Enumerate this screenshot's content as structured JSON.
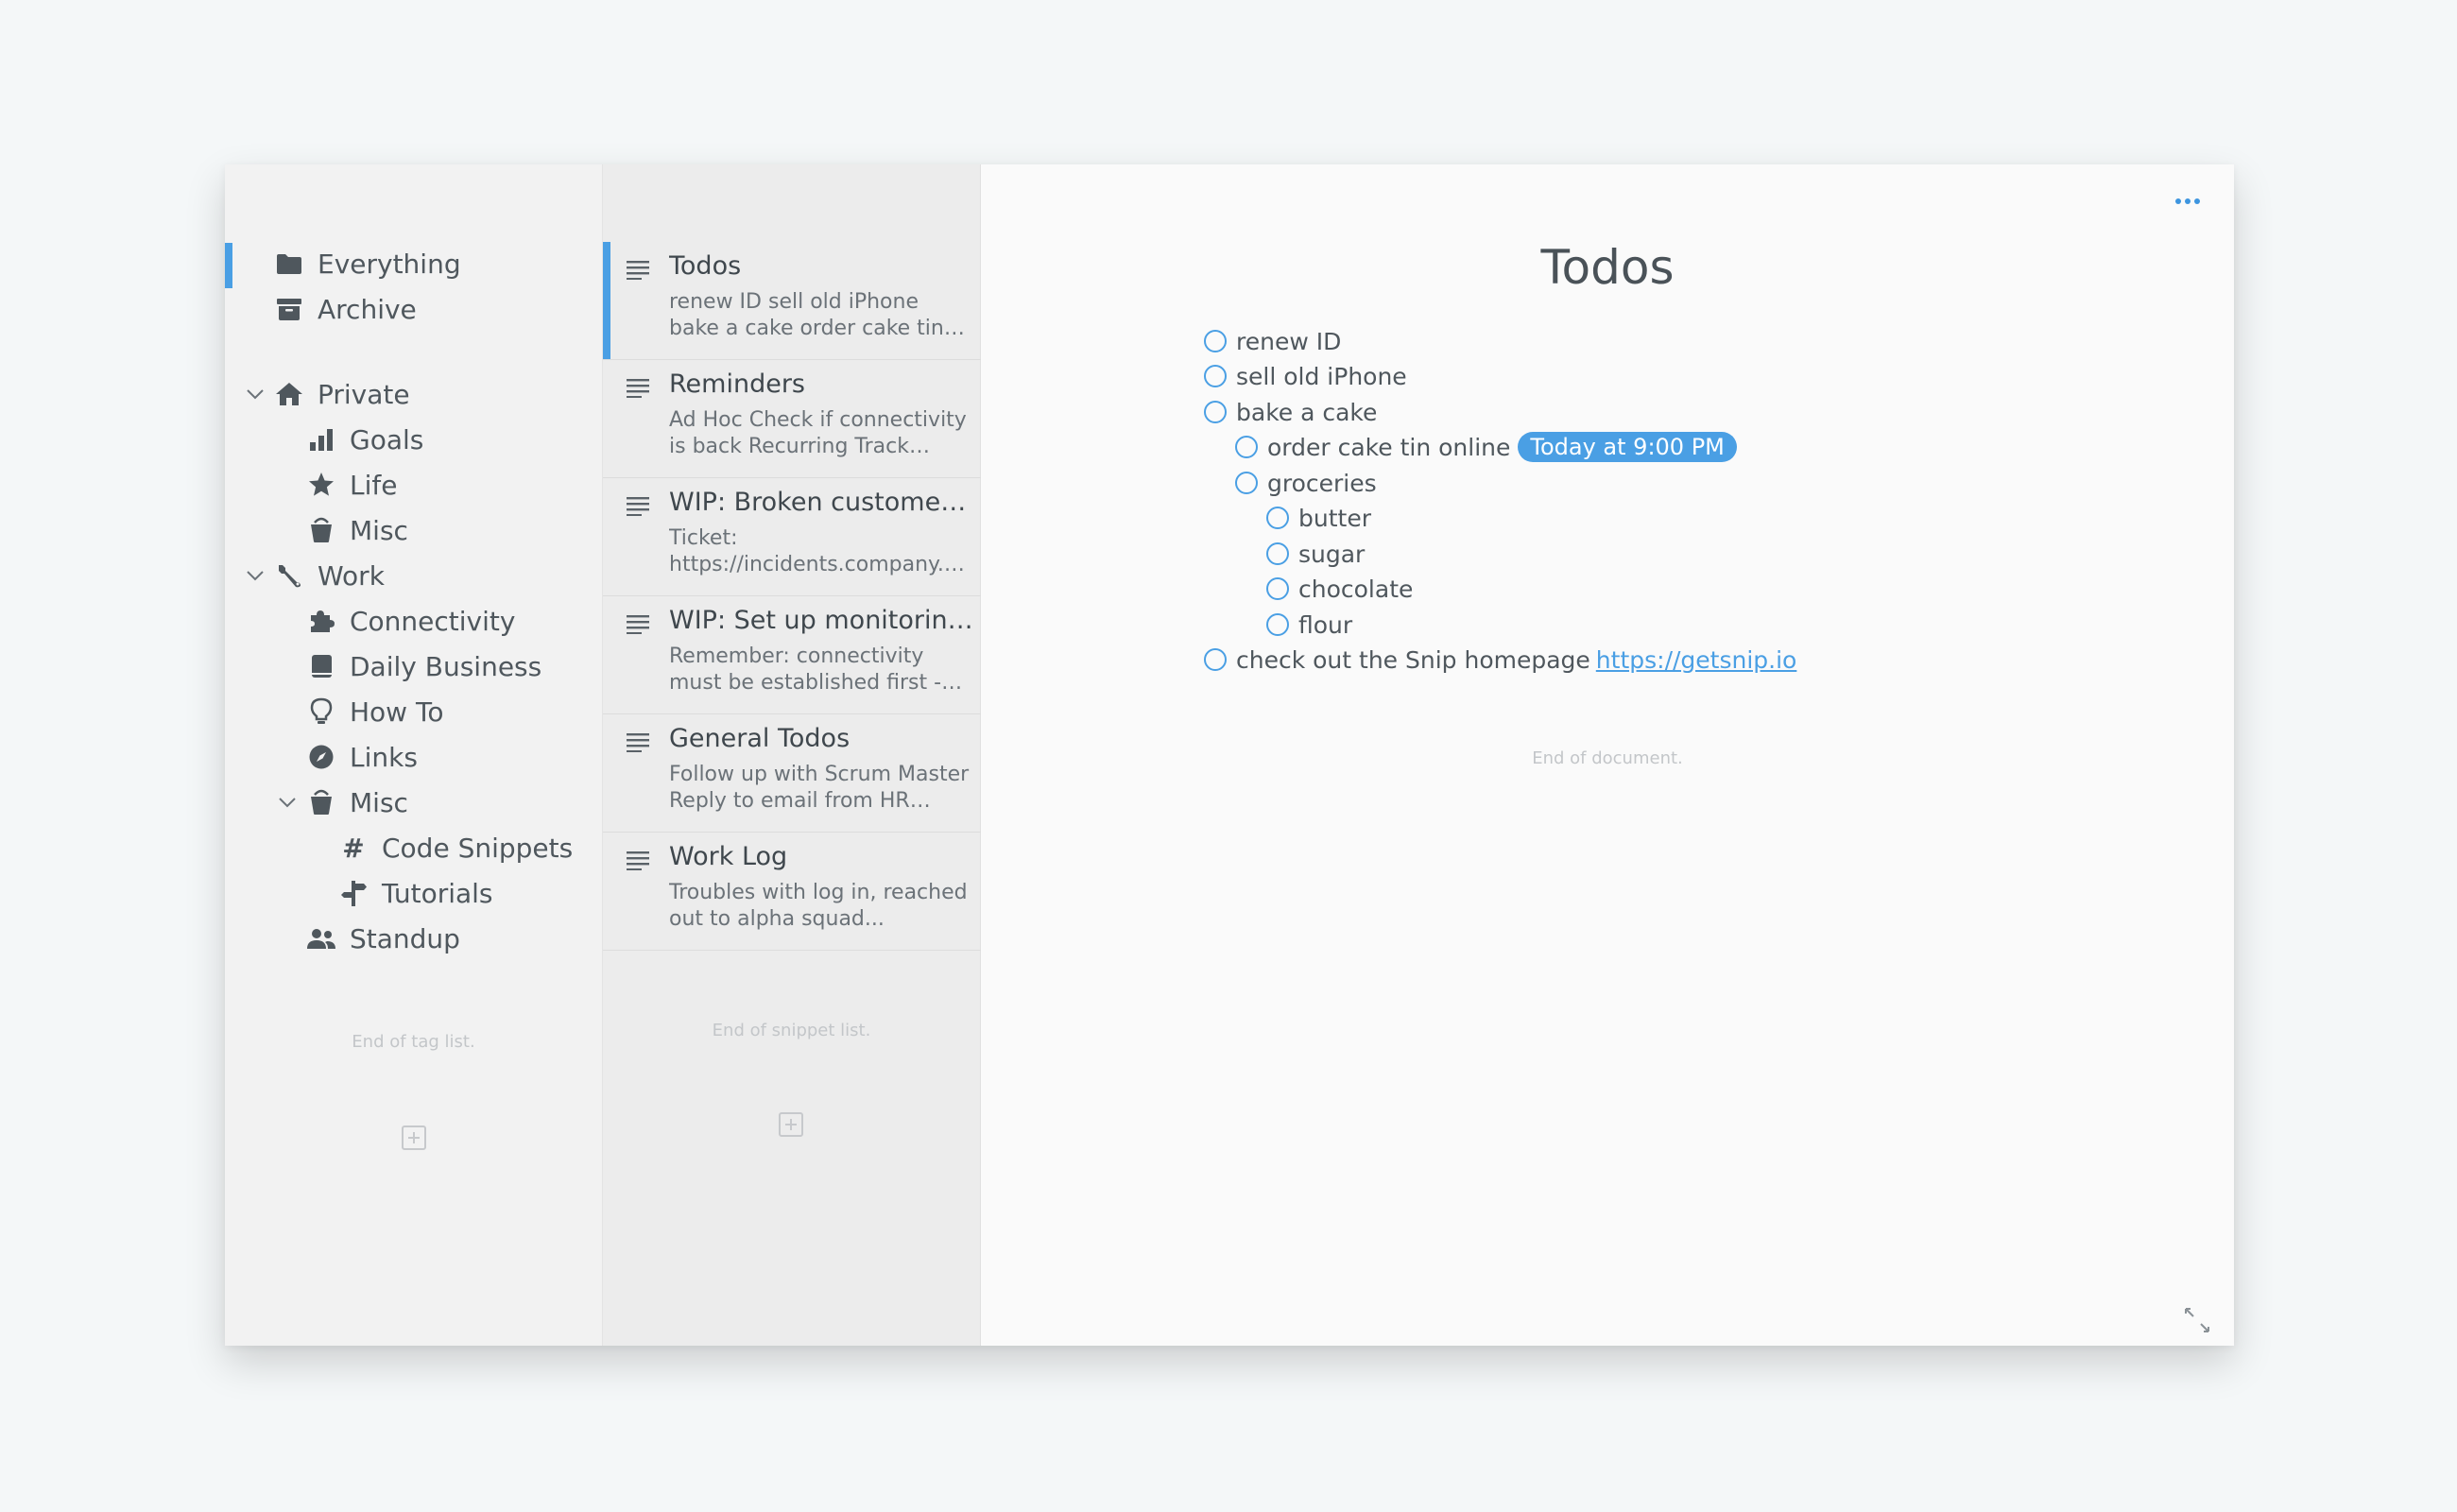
{
  "sidebar": {
    "items": [
      {
        "label": "Everything",
        "icon": "folder-icon"
      },
      {
        "label": "Archive",
        "icon": "archive-icon"
      },
      {
        "label": "Private",
        "icon": "home-icon"
      },
      {
        "label": "Goals",
        "icon": "bar-chart-icon"
      },
      {
        "label": "Life",
        "icon": "star-icon"
      },
      {
        "label": "Misc",
        "icon": "bucket-icon"
      },
      {
        "label": "Work",
        "icon": "wrench-icon"
      },
      {
        "label": "Connectivity",
        "icon": "puzzle-icon"
      },
      {
        "label": "Daily Business",
        "icon": "book-icon"
      },
      {
        "label": "How To",
        "icon": "lightbulb-icon"
      },
      {
        "label": "Links",
        "icon": "compass-icon"
      },
      {
        "label": "Misc",
        "icon": "bucket-icon"
      },
      {
        "label": "Code Snippets",
        "icon": "hash-icon"
      },
      {
        "label": "Tutorials",
        "icon": "signpost-icon"
      },
      {
        "label": "Standup",
        "icon": "users-icon"
      }
    ],
    "end_note": "End of tag list."
  },
  "snippets": {
    "items": [
      {
        "title": "Todos",
        "preview": "renew ID sell old iPhone bake a cake order cake tin online..."
      },
      {
        "title": "Reminders",
        "preview": "Ad Hoc Check if connectivity is back Recurring Track time..."
      },
      {
        "title": "WIP: Broken customer v...",
        "preview": "Ticket: https://incidents.company.co..."
      },
      {
        "title": "WIP: Set up monitoring i...",
        "preview": "Remember: connectivity must be established first - check..."
      },
      {
        "title": "General Todos",
        "preview": "Follow up with Scrum Master Reply to email from HR Follo..."
      },
      {
        "title": "Work Log",
        "preview": "Troubles with log in, reached out to alpha squad..."
      }
    ],
    "end_note": "End of snippet list."
  },
  "editor": {
    "title": "Todos",
    "todos": [
      {
        "text": "renew ID"
      },
      {
        "text": "sell old iPhone"
      },
      {
        "text": "bake a cake"
      },
      {
        "text": "order cake tin online",
        "reminder": "Today at 9:00 PM"
      },
      {
        "text": "groceries"
      },
      {
        "text": "butter"
      },
      {
        "text": "sugar"
      },
      {
        "text": "chocolate"
      },
      {
        "text": "flour"
      },
      {
        "text": "check out the Snip homepage",
        "link": "https://getsnip.io"
      }
    ],
    "end_note": "End of document."
  },
  "colors": {
    "accent": "#4a9fe4"
  }
}
